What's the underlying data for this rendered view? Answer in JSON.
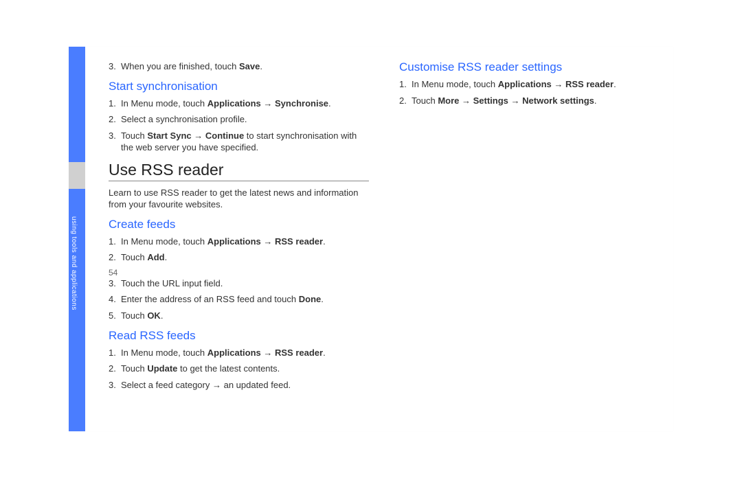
{
  "sidebar_label": "using tools and applications",
  "page_number": "54",
  "col1": {
    "step3_intro": {
      "num": "3.",
      "pre": "When you are finished, touch ",
      "b1": "Save",
      "post": "."
    },
    "h2_start_sync": "Start synchronisation",
    "start_sync": {
      "s1_pre": "In Menu mode, touch ",
      "s1_b1": "Applications",
      "s1_arrow": " → ",
      "s1_b2": "Synchronise",
      "s1_post": ".",
      "s2": "Select a synchronisation profile.",
      "s3_pre": "Touch ",
      "s3_b1": "Start Sync",
      "s3_arrow": " → ",
      "s3_b2": "Continue",
      "s3_post": " to start synchronisation with the web server you have specified."
    },
    "h1_use_rss": "Use RSS reader",
    "use_rss_para": "Learn to use RSS reader to get the latest news and information from your favourite websites.",
    "h2_create": "Create feeds",
    "create": {
      "s1_pre": "In Menu mode, touch ",
      "s1_b1": "Applications",
      "s1_arrow": " → ",
      "s1_b2": "RSS reader",
      "s1_post": ".",
      "s2_pre": "Touch ",
      "s2_b1": "Add",
      "s2_post": "."
    }
  },
  "col2": {
    "create_cont": {
      "s3": "Touch the URL input field.",
      "s4_pre": "Enter the address of an RSS feed and touch ",
      "s4_b1": "Done",
      "s4_post": ".",
      "s5_pre": "Touch ",
      "s5_b1": "OK",
      "s5_post": "."
    },
    "h2_read": "Read RSS feeds",
    "read": {
      "s1_pre": "In Menu mode, touch ",
      "s1_b1": "Applications",
      "s1_arrow": " → ",
      "s1_b2": "RSS reader",
      "s1_post": ".",
      "s2_pre": "Touch ",
      "s2_b1": "Update",
      "s2_post": " to get the latest contents.",
      "s3": "Select a feed category → an updated feed."
    },
    "h2_customise": "Customise RSS reader settings",
    "customise": {
      "s1_pre": "In Menu mode, touch ",
      "s1_b1": "Applications",
      "s1_arrow": " → ",
      "s1_b2": "RSS reader",
      "s1_post": ".",
      "s2_pre": "Touch ",
      "s2_b1": "More",
      "s2_arrow1": " → ",
      "s2_b2": "Settings",
      "s2_arrow2": " → ",
      "s2_b3": "Network settings",
      "s2_post": "."
    }
  }
}
